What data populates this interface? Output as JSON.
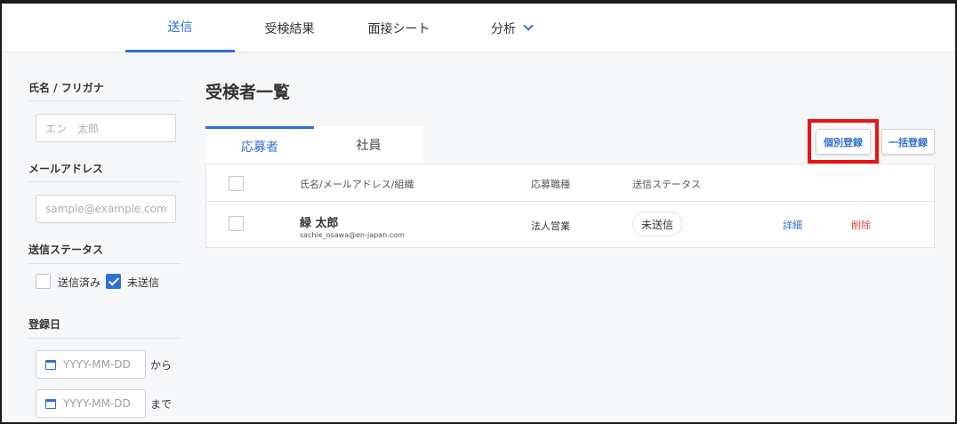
{
  "nav": {
    "tabs": [
      {
        "label": "送信",
        "active": true
      },
      {
        "label": "受検結果",
        "active": false
      },
      {
        "label": "面接シート",
        "active": false
      },
      {
        "label": "分析",
        "active": false
      }
    ]
  },
  "sidebar": {
    "name_heading": "氏名 / フリガナ",
    "name_placeholder": "エン　太郎",
    "email_heading": "メールアドレス",
    "email_placeholder": "sample@example.com",
    "status_heading": "送信ステータス",
    "status_options": [
      {
        "label": "送信済み",
        "checked": false
      },
      {
        "label": "未送信",
        "checked": true
      }
    ],
    "date_heading": "登録日",
    "date_from_placeholder": "YYYY-MM-DD",
    "date_from_suffix": "から",
    "date_to_placeholder": "YYYY-MM-DD",
    "date_to_suffix": "まで"
  },
  "main": {
    "title": "受検者一覧",
    "tabs": [
      {
        "label": "応募者",
        "active": true
      },
      {
        "label": "社員",
        "active": false
      }
    ],
    "buttons": {
      "individual_register": "個別登録",
      "bulk_register": "一括登録"
    },
    "table": {
      "headers": [
        "氏名/メールアドレス/組織",
        "応募職種",
        "送信ステータス"
      ],
      "rows": [
        {
          "name": "緑 太郎",
          "email": "sachie_osawa@en-japan.com",
          "job": "法人営業",
          "status": "未送信",
          "detail": "詳細",
          "delete": "削除"
        }
      ]
    }
  },
  "colors": {
    "accent": "#2f6fd6",
    "danger": "#e0453a",
    "highlight": "#ee1111"
  }
}
